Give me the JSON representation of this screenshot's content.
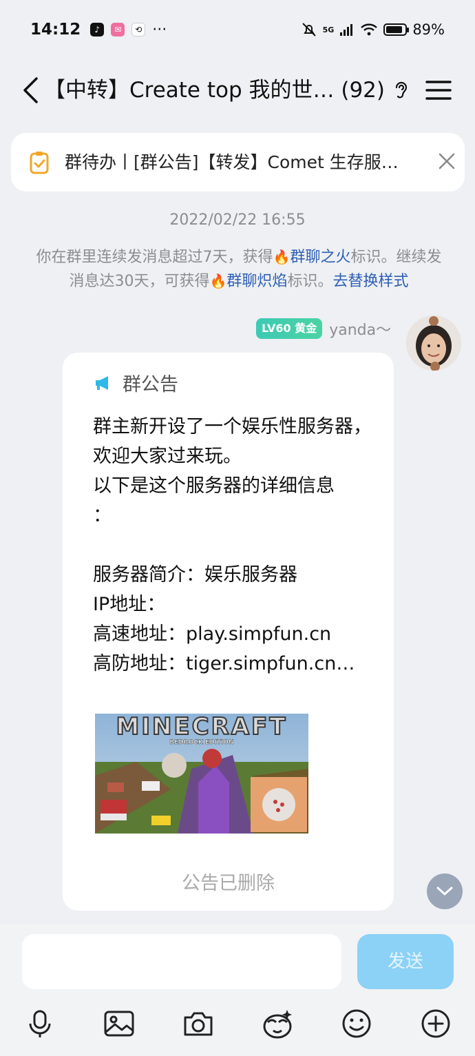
{
  "status_bar": {
    "time": "14:12",
    "more": "···",
    "network": "5G",
    "battery": "89%",
    "battery_level": 0.89
  },
  "header": {
    "title": "【中转】Create top 我的世… (92)"
  },
  "todo_banner": {
    "text": "群待办丨[群公告]【转发】Comet 生存服…"
  },
  "timestamp": "2022/02/22 16:55",
  "system_message": {
    "part1": "你在群里连续发消息超过7天，获得",
    "link1": "群聊之火",
    "part2": "标识。继续发消息达30天，可获得",
    "link2": "群聊炽焰",
    "part3": "标识。",
    "link3": "去替换样式"
  },
  "message": {
    "level_badge": "LV60 黄金",
    "sender": "yanda～",
    "notice_title": "群公告",
    "notice_body": "群主新开设了一个娱乐性服务器，欢迎大家过来玩。\n以下是这个服务器的详细信息\n：\n\n服务器简介：娱乐服务器\nIP地址：\n高速地址：play.simpfun.cn\n高防地址：tiger.simpfun.cn…",
    "image_title": "MINECRAFT",
    "image_subtitle": "BEDROCK EDITION",
    "notice_status": "公告已删除"
  },
  "input": {
    "placeholder": "",
    "send_label": "发送"
  },
  "colors": {
    "background": "#eef0f3",
    "link": "#2d5fb4",
    "send_button": "#8cd1f6",
    "level_badge": "#3ec9b4"
  }
}
